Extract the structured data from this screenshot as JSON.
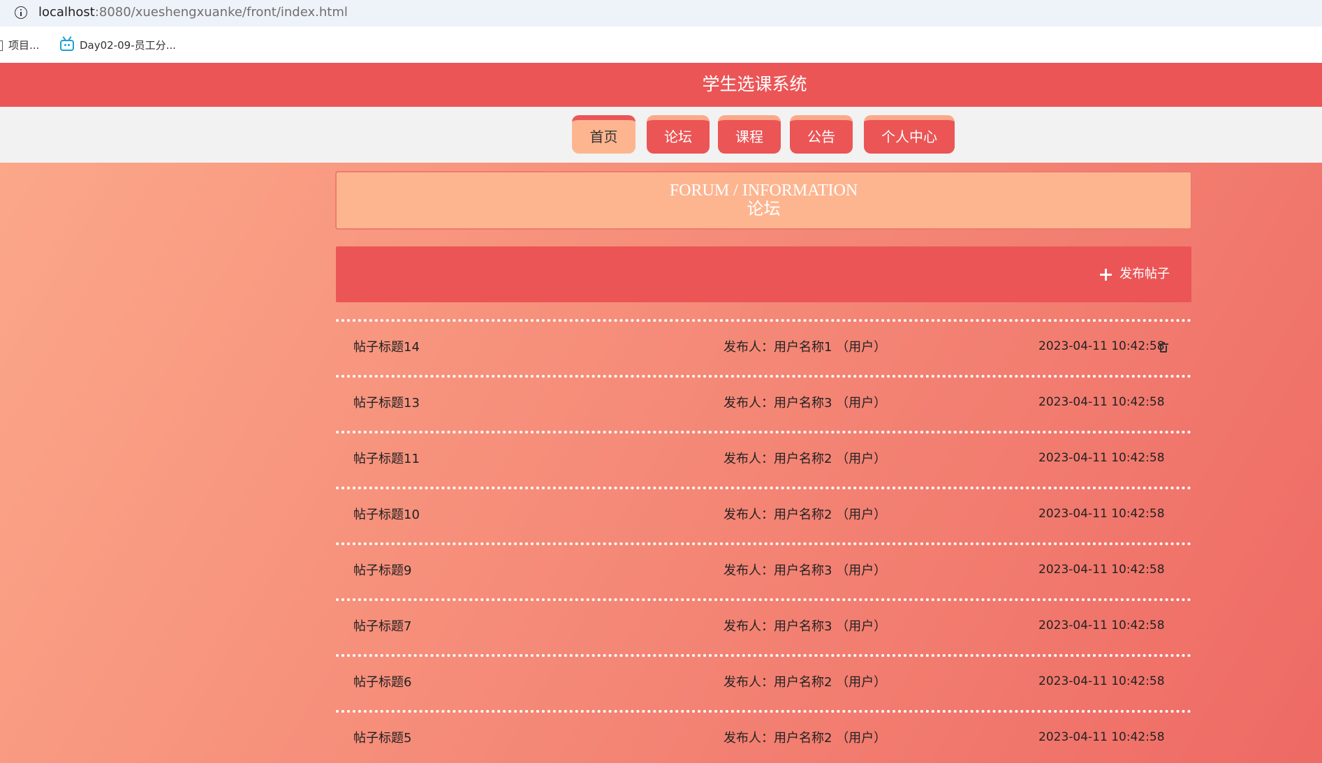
{
  "browser": {
    "url_host": "localhost",
    "url_rest": ":8080/xueshengxuanke/front/index.html",
    "bookmarks": [
      {
        "label": "项目..."
      },
      {
        "label": "Day02-09-员工分..."
      }
    ]
  },
  "header": {
    "title": "学生选课系统"
  },
  "nav": {
    "items": [
      {
        "label": "首页"
      },
      {
        "label": "论坛"
      },
      {
        "label": "课程"
      },
      {
        "label": "公告"
      },
      {
        "label": "个人中心"
      }
    ]
  },
  "forum": {
    "title_en": "FORUM / INFORMATION",
    "title_cn": "论坛",
    "post_button_label": "发布帖子"
  },
  "colors": {
    "primary": "#eb5556",
    "secondary": "#fdb590",
    "gradient_start": "#fca98a",
    "gradient_end": "#ee6a64"
  },
  "posts": [
    {
      "title": "帖子标题14",
      "author": "发布人：用户名称1  （用户）",
      "time": "2023-04-11 10:42:58"
    },
    {
      "title": "帖子标题13",
      "author": "发布人：用户名称3  （用户）",
      "time": "2023-04-11 10:42:58"
    },
    {
      "title": "帖子标题11",
      "author": "发布人：用户名称2  （用户）",
      "time": "2023-04-11 10:42:58"
    },
    {
      "title": "帖子标题10",
      "author": "发布人：用户名称2  （用户）",
      "time": "2023-04-11 10:42:58"
    },
    {
      "title": "帖子标题9",
      "author": "发布人：用户名称3  （用户）",
      "time": "2023-04-11 10:42:58"
    },
    {
      "title": "帖子标题7",
      "author": "发布人：用户名称3  （用户）",
      "time": "2023-04-11 10:42:58"
    },
    {
      "title": "帖子标题6",
      "author": "发布人：用户名称2  （用户）",
      "time": "2023-04-11 10:42:58"
    },
    {
      "title": "帖子标题5",
      "author": "发布人：用户名称2  （用户）",
      "time": "2023-04-11 10:42:58"
    }
  ]
}
